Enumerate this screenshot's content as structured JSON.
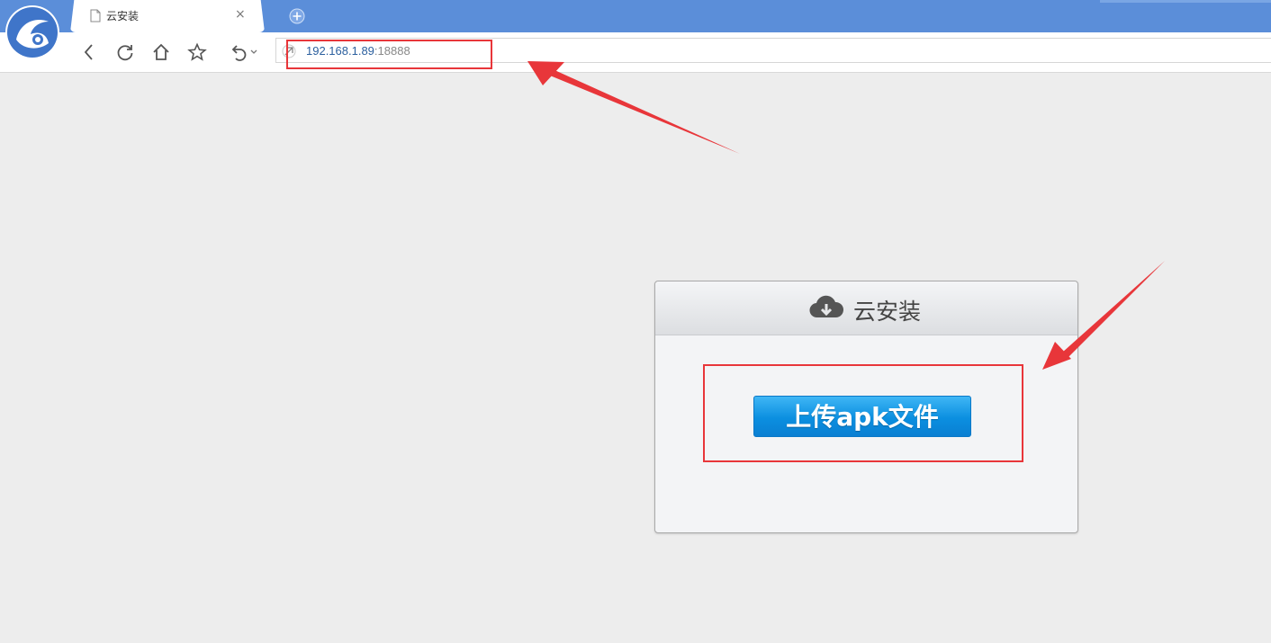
{
  "browser": {
    "tab": {
      "title": "云安装",
      "close_label": "×"
    },
    "address": {
      "host": "192.168.1.89",
      "port": ":18888"
    },
    "icons": {
      "logo": "uc-browser-logo-icon",
      "back": "back-icon",
      "reload": "reload-icon",
      "home": "home-icon",
      "favorite": "star-icon",
      "undo": "undo-icon",
      "new_tab": "new-tab-icon"
    },
    "colors": {
      "tab_strip": "#5b8ed9",
      "annotation": "#e8363a"
    }
  },
  "page": {
    "panel_title": "云安装",
    "upload_button": "上传apk文件",
    "colors": {
      "button_top": "#3fb6f5",
      "button_bottom": "#0a7fd2"
    }
  }
}
